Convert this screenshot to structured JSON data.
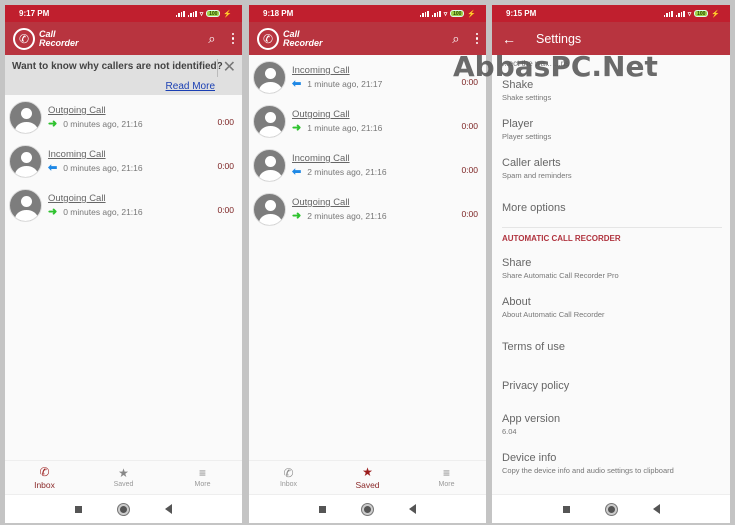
{
  "brand": {
    "primary": "#b8343f",
    "status_bar": "#c01f2e",
    "outgoing": "#2ec22e",
    "incoming": "#1e88e5",
    "duration": "#7a1f1f"
  },
  "app": {
    "logo_line1": "Call",
    "logo_line2": "Recorder",
    "logo_icon": "phone-icon"
  },
  "screens": [
    {
      "time": "9:17 PM",
      "battery": "100",
      "banner": {
        "question": "Want to know why callers are not identified?",
        "link": "Read More"
      },
      "calls": [
        {
          "title": "Outgoing Call",
          "direction": "outgoing",
          "when": "0 minutes ago, 21:16",
          "duration": "0:00"
        },
        {
          "title": "Incoming Call",
          "direction": "incoming",
          "when": "0 minutes ago, 21:16",
          "duration": "0:00"
        },
        {
          "title": "Outgoing Call",
          "direction": "outgoing",
          "when": "0 minutes ago, 21:16",
          "duration": "0:00"
        }
      ],
      "nav": [
        {
          "label": "Inbox",
          "icon": "phone-icon",
          "active": true
        },
        {
          "label": "Saved",
          "icon": "star-icon"
        },
        {
          "label": "More",
          "icon": "menu-icon"
        }
      ]
    },
    {
      "time": "9:18 PM",
      "battery": "100",
      "calls": [
        {
          "title": "Incoming Call",
          "direction": "incoming",
          "when": "1 minute ago, 21:17",
          "duration": "0:00"
        },
        {
          "title": "Outgoing Call",
          "direction": "outgoing",
          "when": "1 minute ago, 21:16",
          "duration": "0:00"
        },
        {
          "title": "Incoming Call",
          "direction": "incoming",
          "when": "2 minutes ago, 21:16",
          "duration": "0:00"
        },
        {
          "title": "Outgoing Call",
          "direction": "outgoing",
          "when": "2 minutes ago, 21:16",
          "duration": "0:00"
        }
      ],
      "nav": [
        {
          "label": "Inbox",
          "icon": "phone-icon"
        },
        {
          "label": "Saved",
          "icon": "star-icon",
          "active": true
        },
        {
          "label": "More",
          "icon": "menu-icon"
        }
      ]
    },
    {
      "time": "9:15 PM",
      "battery": "100",
      "title": "Settings",
      "partial_item": "...ect the wa... ...ns",
      "items": [
        {
          "title": "Shake",
          "sub": "Shake settings"
        },
        {
          "title": "Player",
          "sub": "Player settings"
        },
        {
          "title": "Caller alerts",
          "sub": "Spam and reminders"
        },
        {
          "title": "More options",
          "sub": ""
        }
      ],
      "section": "AUTOMATIC CALL RECORDER",
      "items2": [
        {
          "title": "Share",
          "sub": "Share Automatic Call Recorder Pro"
        },
        {
          "title": "About",
          "sub": "About Automatic Call Recorder"
        },
        {
          "title": "Terms of use",
          "sub": ""
        },
        {
          "title": "Privacy policy",
          "sub": ""
        },
        {
          "title": "App version",
          "sub": "6.04"
        },
        {
          "title": "Device info",
          "sub": "Copy the device info and audio settings to clipboard"
        }
      ]
    }
  ],
  "watermark": "AbbasPC.Net"
}
